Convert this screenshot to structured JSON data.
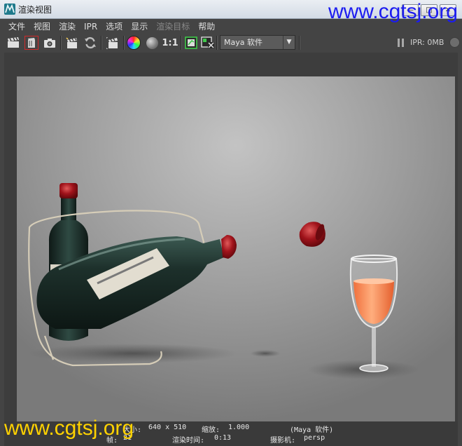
{
  "window": {
    "title": "渲染视图",
    "controls": {
      "minimize": "—",
      "maximize": "□",
      "close": "✕"
    }
  },
  "watermark": {
    "text": "www.cgtsj.org"
  },
  "menu": [
    {
      "label": "文件",
      "enabled": true
    },
    {
      "label": "视图",
      "enabled": true
    },
    {
      "label": "渲染",
      "enabled": true
    },
    {
      "label": "IPR",
      "enabled": true
    },
    {
      "label": "选项",
      "enabled": true
    },
    {
      "label": "显示",
      "enabled": true
    },
    {
      "label": "渲染目标",
      "enabled": false
    },
    {
      "label": "帮助",
      "enabled": true
    }
  ],
  "toolbar": {
    "icons": [
      "clapper-icon",
      "render-region-icon",
      "camera-snapshot-icon",
      "ipr-clapper-icon",
      "refresh-icon",
      "region-render-icon",
      "color-wheel-icon",
      "sphere-icon",
      "ratio-icon",
      "keep-image-icon",
      "remove-image-icon"
    ],
    "ratio_label": "1:1",
    "renderer": "Maya 软件",
    "ipr_memory": "IPR: 0MB"
  },
  "status": {
    "size_label": "大小:",
    "size_value": "640 x 510",
    "zoom_label": "缩放:",
    "zoom_value": "1.000",
    "renderer": "(Maya 软件)",
    "frame_label": "帧:",
    "frame_value": "21",
    "render_time_label": "渲染时间:",
    "render_time_value": "0:13",
    "camera_label": "摄影机:",
    "camera_value": "persp"
  },
  "colors": {
    "ui_background": "#444444",
    "watermark_top": "#1c1cf0",
    "watermark_bottom": "#ffd200",
    "selection_outline": "#d02b2b"
  }
}
